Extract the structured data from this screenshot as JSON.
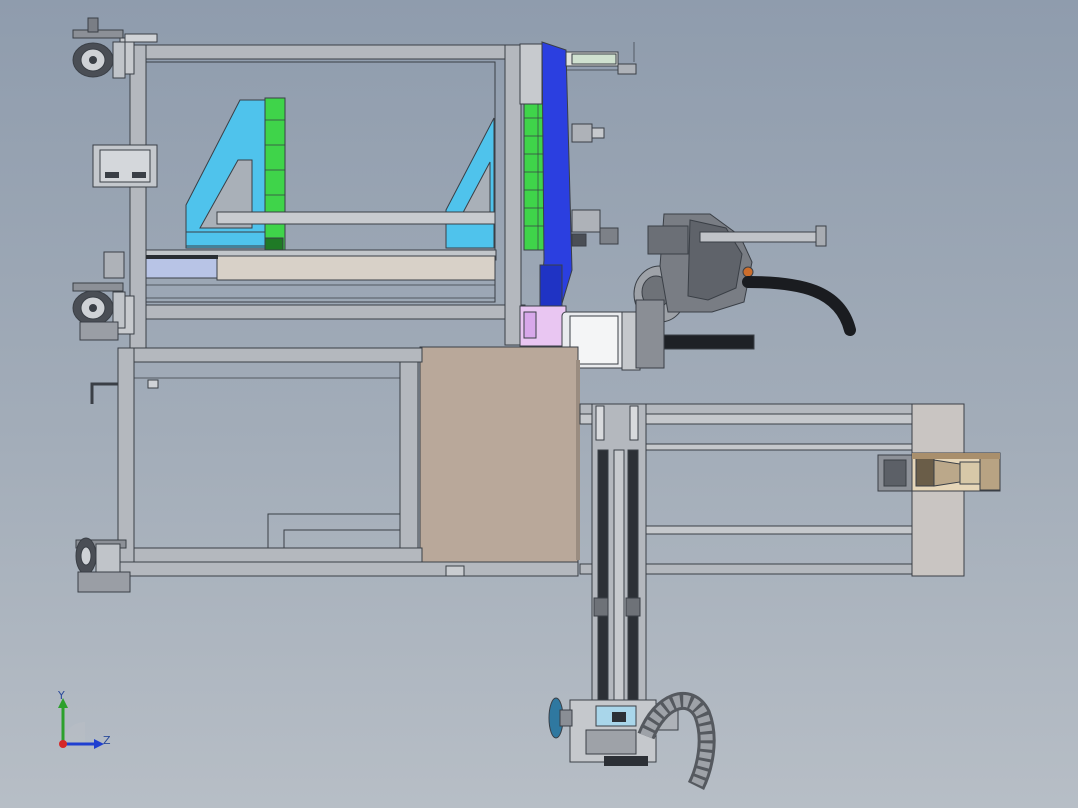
{
  "triad": {
    "y_label": "Y",
    "z_label": "Z"
  },
  "colors": {
    "background_top": "#8f9cad",
    "background_bottom": "#b7bec6",
    "frame_gray": "#b4b8be",
    "gusset_cyan": "#4fc3ec",
    "tray_green": "#3fd44a",
    "carriage_blue": "#2b3fe0",
    "panel_tan": "#b9a89a",
    "axis_y_green": "#2ca02c",
    "axis_z_blue": "#1f3fd0",
    "axis_origin_red": "#d62728"
  },
  "icons": [
    "coordinate-triad-icon"
  ]
}
